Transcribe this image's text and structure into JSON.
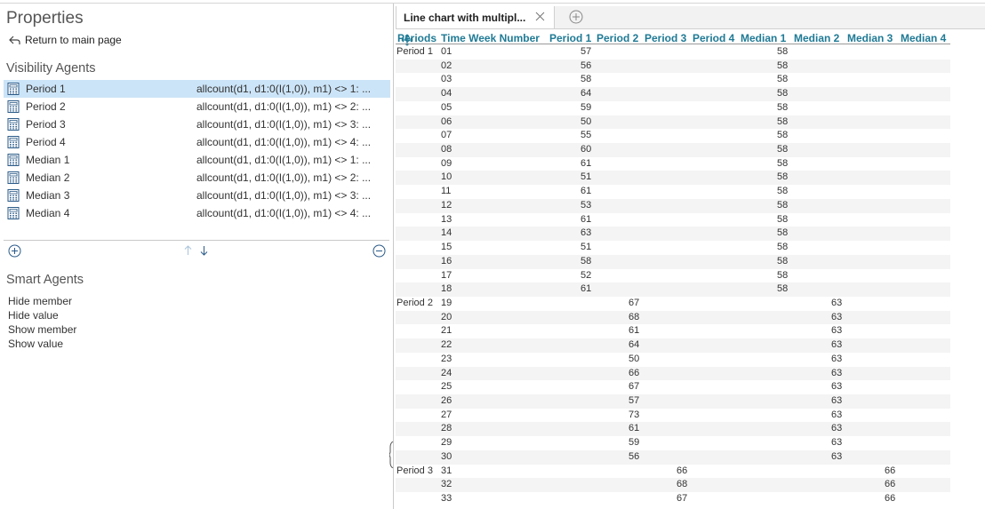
{
  "properties": {
    "title": "Properties",
    "back_label": "Return to main page",
    "visibility_title": "Visibility Agents",
    "agents": [
      {
        "name": "Period 1",
        "expr": "allcount(d1, d1:0(I(1,0)), m1) <> 1: ..."
      },
      {
        "name": "Period 2",
        "expr": "allcount(d1, d1:0(I(1,0)), m1) <> 2: ..."
      },
      {
        "name": "Period 3",
        "expr": "allcount(d1, d1:0(I(1,0)), m1) <> 3: ..."
      },
      {
        "name": "Period 4",
        "expr": "allcount(d1, d1:0(I(1,0)), m1) <> 4: ..."
      },
      {
        "name": "Median 1",
        "expr": "allcount(d1, d1:0(I(1,0)), m1) <> 1: ..."
      },
      {
        "name": "Median 2",
        "expr": "allcount(d1, d1:0(I(1,0)), m1) <> 2: ..."
      },
      {
        "name": "Median 3",
        "expr": "allcount(d1, d1:0(I(1,0)), m1) <> 3: ..."
      },
      {
        "name": "Median 4",
        "expr": "allcount(d1, d1:0(I(1,0)), m1) <> 4: ..."
      }
    ],
    "selected_agent": "Period 1",
    "smart_title": "Smart Agents",
    "smart_items": [
      "Hide member",
      "Hide value",
      "Show member",
      "Show value"
    ]
  },
  "tab": {
    "label": "Line chart with multipl..."
  },
  "table": {
    "columns": [
      "Periods",
      "Time Week Number",
      "Period 1",
      "Period 2",
      "Period 3",
      "Period 4",
      "Median 1",
      "Median 2",
      "Median 3",
      "Median 4"
    ],
    "rows": [
      {
        "period": "Period 1",
        "week": "01",
        "p1": "57",
        "p2": "",
        "p3": "",
        "m1": "58",
        "m2": "",
        "m3": ""
      },
      {
        "period": "",
        "week": "02",
        "p1": "56",
        "p2": "",
        "p3": "",
        "m1": "58",
        "m2": "",
        "m3": ""
      },
      {
        "period": "",
        "week": "03",
        "p1": "58",
        "p2": "",
        "p3": "",
        "m1": "58",
        "m2": "",
        "m3": ""
      },
      {
        "period": "",
        "week": "04",
        "p1": "64",
        "p2": "",
        "p3": "",
        "m1": "58",
        "m2": "",
        "m3": ""
      },
      {
        "period": "",
        "week": "05",
        "p1": "59",
        "p2": "",
        "p3": "",
        "m1": "58",
        "m2": "",
        "m3": ""
      },
      {
        "period": "",
        "week": "06",
        "p1": "50",
        "p2": "",
        "p3": "",
        "m1": "58",
        "m2": "",
        "m3": ""
      },
      {
        "period": "",
        "week": "07",
        "p1": "55",
        "p2": "",
        "p3": "",
        "m1": "58",
        "m2": "",
        "m3": ""
      },
      {
        "period": "",
        "week": "08",
        "p1": "60",
        "p2": "",
        "p3": "",
        "m1": "58",
        "m2": "",
        "m3": ""
      },
      {
        "period": "",
        "week": "09",
        "p1": "61",
        "p2": "",
        "p3": "",
        "m1": "58",
        "m2": "",
        "m3": ""
      },
      {
        "period": "",
        "week": "10",
        "p1": "51",
        "p2": "",
        "p3": "",
        "m1": "58",
        "m2": "",
        "m3": ""
      },
      {
        "period": "",
        "week": "11",
        "p1": "61",
        "p2": "",
        "p3": "",
        "m1": "58",
        "m2": "",
        "m3": ""
      },
      {
        "period": "",
        "week": "12",
        "p1": "53",
        "p2": "",
        "p3": "",
        "m1": "58",
        "m2": "",
        "m3": ""
      },
      {
        "period": "",
        "week": "13",
        "p1": "61",
        "p2": "",
        "p3": "",
        "m1": "58",
        "m2": "",
        "m3": ""
      },
      {
        "period": "",
        "week": "14",
        "p1": "63",
        "p2": "",
        "p3": "",
        "m1": "58",
        "m2": "",
        "m3": ""
      },
      {
        "period": "",
        "week": "15",
        "p1": "51",
        "p2": "",
        "p3": "",
        "m1": "58",
        "m2": "",
        "m3": ""
      },
      {
        "period": "",
        "week": "16",
        "p1": "58",
        "p2": "",
        "p3": "",
        "m1": "58",
        "m2": "",
        "m3": ""
      },
      {
        "period": "",
        "week": "17",
        "p1": "52",
        "p2": "",
        "p3": "",
        "m1": "58",
        "m2": "",
        "m3": ""
      },
      {
        "period": "",
        "week": "18",
        "p1": "61",
        "p2": "",
        "p3": "",
        "m1": "58",
        "m2": "",
        "m3": ""
      },
      {
        "period": "Period 2",
        "week": "19",
        "p1": "",
        "p2": "67",
        "p3": "",
        "m1": "",
        "m2": "63",
        "m3": ""
      },
      {
        "period": "",
        "week": "20",
        "p1": "",
        "p2": "68",
        "p3": "",
        "m1": "",
        "m2": "63",
        "m3": ""
      },
      {
        "period": "",
        "week": "21",
        "p1": "",
        "p2": "61",
        "p3": "",
        "m1": "",
        "m2": "63",
        "m3": ""
      },
      {
        "period": "",
        "week": "22",
        "p1": "",
        "p2": "64",
        "p3": "",
        "m1": "",
        "m2": "63",
        "m3": ""
      },
      {
        "period": "",
        "week": "23",
        "p1": "",
        "p2": "50",
        "p3": "",
        "m1": "",
        "m2": "63",
        "m3": ""
      },
      {
        "period": "",
        "week": "24",
        "p1": "",
        "p2": "66",
        "p3": "",
        "m1": "",
        "m2": "63",
        "m3": ""
      },
      {
        "period": "",
        "week": "25",
        "p1": "",
        "p2": "67",
        "p3": "",
        "m1": "",
        "m2": "63",
        "m3": ""
      },
      {
        "period": "",
        "week": "26",
        "p1": "",
        "p2": "57",
        "p3": "",
        "m1": "",
        "m2": "63",
        "m3": ""
      },
      {
        "period": "",
        "week": "27",
        "p1": "",
        "p2": "73",
        "p3": "",
        "m1": "",
        "m2": "63",
        "m3": ""
      },
      {
        "period": "",
        "week": "28",
        "p1": "",
        "p2": "61",
        "p3": "",
        "m1": "",
        "m2": "63",
        "m3": ""
      },
      {
        "period": "",
        "week": "29",
        "p1": "",
        "p2": "59",
        "p3": "",
        "m1": "",
        "m2": "63",
        "m3": ""
      },
      {
        "period": "",
        "week": "30",
        "p1": "",
        "p2": "56",
        "p3": "",
        "m1": "",
        "m2": "63",
        "m3": ""
      },
      {
        "period": "Period 3",
        "week": "31",
        "p1": "",
        "p2": "",
        "p3": "66",
        "m1": "",
        "m2": "",
        "m3": "66"
      },
      {
        "period": "",
        "week": "32",
        "p1": "",
        "p2": "",
        "p3": "68",
        "m1": "",
        "m2": "",
        "m3": "66"
      },
      {
        "period": "",
        "week": "33",
        "p1": "",
        "p2": "",
        "p3": "67",
        "m1": "",
        "m2": "",
        "m3": "66"
      }
    ]
  },
  "colors": {
    "header_text": "#1f7a95",
    "selected_row": "#cce4f7"
  }
}
